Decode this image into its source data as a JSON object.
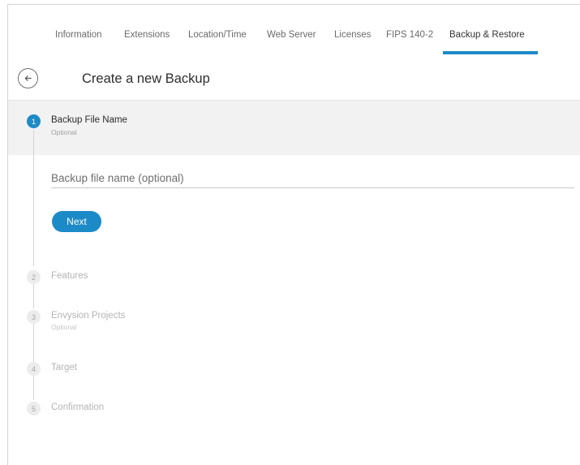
{
  "tabs": [
    {
      "label": "Information"
    },
    {
      "label": "Extensions"
    },
    {
      "label": "Location/Time"
    },
    {
      "label": "Web Server"
    },
    {
      "label": "Licenses"
    },
    {
      "label": "FIPS 140-2"
    },
    {
      "label": "Backup & Restore"
    }
  ],
  "active_tab": "Backup & Restore",
  "header": {
    "title": "Create a new Backup",
    "back_icon": "arrow-left-icon"
  },
  "steps": [
    {
      "number": "1",
      "title": "Backup File Name",
      "subtitle": "Optional",
      "state": "active"
    },
    {
      "number": "2",
      "title": "Features",
      "subtitle": "",
      "state": "inactive"
    },
    {
      "number": "3",
      "title": "Envysion Projects",
      "subtitle": "Optional",
      "state": "inactive"
    },
    {
      "number": "4",
      "title": "Target",
      "subtitle": "",
      "state": "inactive"
    },
    {
      "number": "5",
      "title": "Confirmation",
      "subtitle": "",
      "state": "inactive"
    }
  ],
  "form": {
    "file_name_value": "",
    "file_name_placeholder": "Backup file name (optional)",
    "next_label": "Next"
  },
  "colors": {
    "accent": "#1d8ac8",
    "active_band": "#f2f2f2",
    "inactive_text": "#b4b4b4"
  }
}
